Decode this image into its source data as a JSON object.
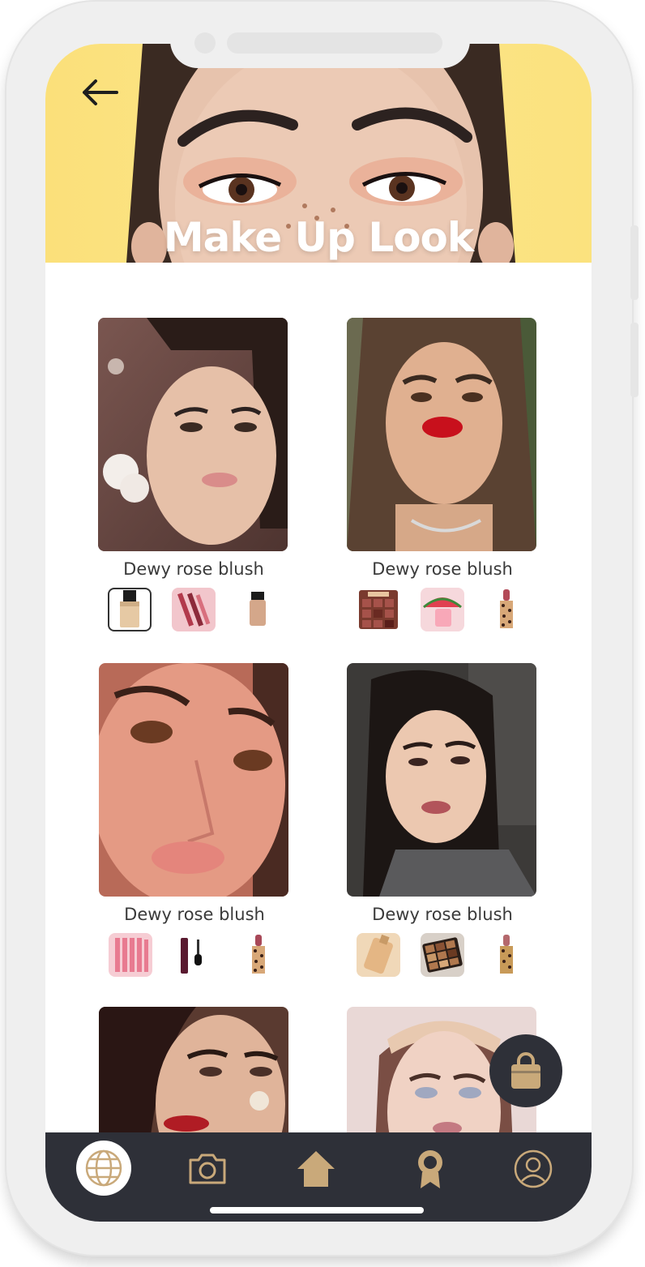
{
  "header": {
    "title": "Make Up Look",
    "back_icon": "arrow-left-icon"
  },
  "looks": [
    {
      "name": "Dewy rose blush",
      "products": [
        "foundation-bottle",
        "lipstick-set",
        "loose-pigment"
      ],
      "selected_product": 0
    },
    {
      "name": "Dewy rose blush",
      "products": [
        "nude-eyeshadow-palette",
        "watermelon-skincare",
        "leopard-lipstick"
      ]
    },
    {
      "name": "Dewy rose blush",
      "products": [
        "lip-gloss-set",
        "mascara",
        "leopard-lipstick"
      ]
    },
    {
      "name": "Dewy rose blush",
      "products": [
        "foundation-bottle",
        "bronze-eyeshadow-palette",
        "gold-lipstick"
      ]
    },
    {
      "name": ""
    },
    {
      "name": ""
    }
  ],
  "fab": {
    "icon": "shopping-bag-icon"
  },
  "bottom_nav": {
    "active": "explore",
    "items": [
      {
        "id": "explore",
        "icon": "globe-icon"
      },
      {
        "id": "camera",
        "icon": "camera-icon"
      },
      {
        "id": "home",
        "icon": "home-icon"
      },
      {
        "id": "rewards",
        "icon": "award-icon"
      },
      {
        "id": "profile",
        "icon": "user-icon"
      }
    ]
  },
  "colors": {
    "hero_bg": "#fce58a",
    "nav_bg": "#2e3038",
    "accent_gold": "#c9a97a",
    "text": "#3a3a3a"
  }
}
